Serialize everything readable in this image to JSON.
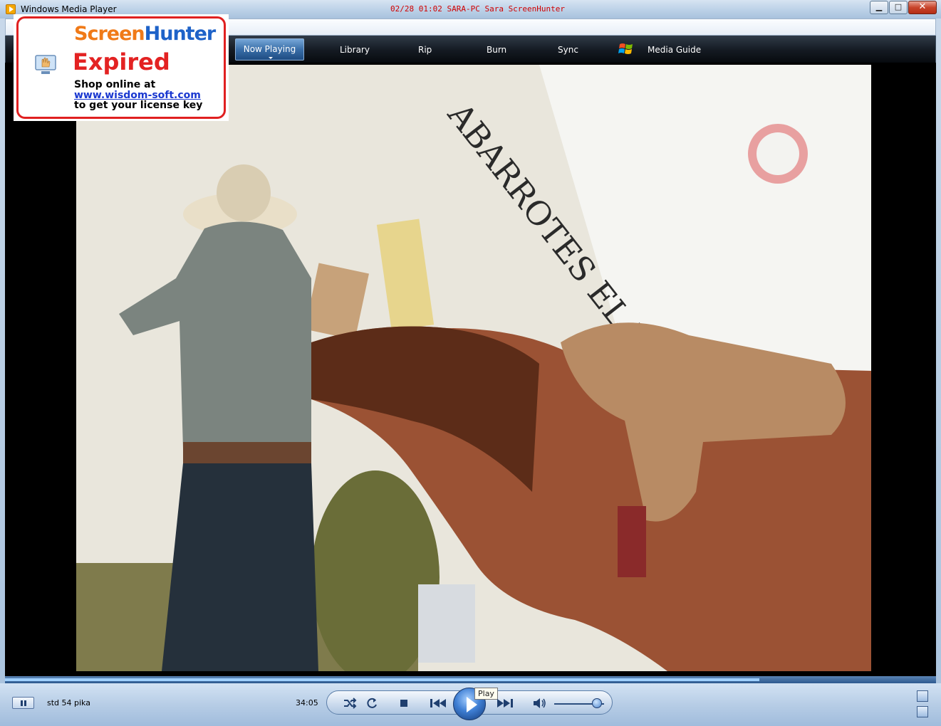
{
  "window": {
    "title": "Windows Media Player",
    "overlay": "02/28  01:02  SARA-PC  Sara  ScreenHunter"
  },
  "nav": {
    "tabs": [
      {
        "label": "Now Playing",
        "active": true
      },
      {
        "label": "Library"
      },
      {
        "label": "Rip"
      },
      {
        "label": "Burn"
      },
      {
        "label": "Sync"
      },
      {
        "label": "Media Guide"
      }
    ]
  },
  "watermark": {
    "brand_a": "Screen",
    "brand_b": "Hunter",
    "status": "Expired",
    "line1": "Shop online at",
    "url": "www.wisdom-soft.com",
    "line3": "to get your license key"
  },
  "player": {
    "track": "std 54 pika",
    "time": "34:05",
    "tooltip": "Play",
    "progress": 0.81,
    "volume": 0.85
  },
  "video_frame": {
    "sign_text": "ABARROTES EL TRIUNFO"
  },
  "colors": {
    "nav_bg": "#141a22",
    "accent_blue": "#3a6ea8",
    "overlay_red": "#d00000",
    "watermark_red": "#e32222",
    "link_blue": "#1a38d0"
  }
}
